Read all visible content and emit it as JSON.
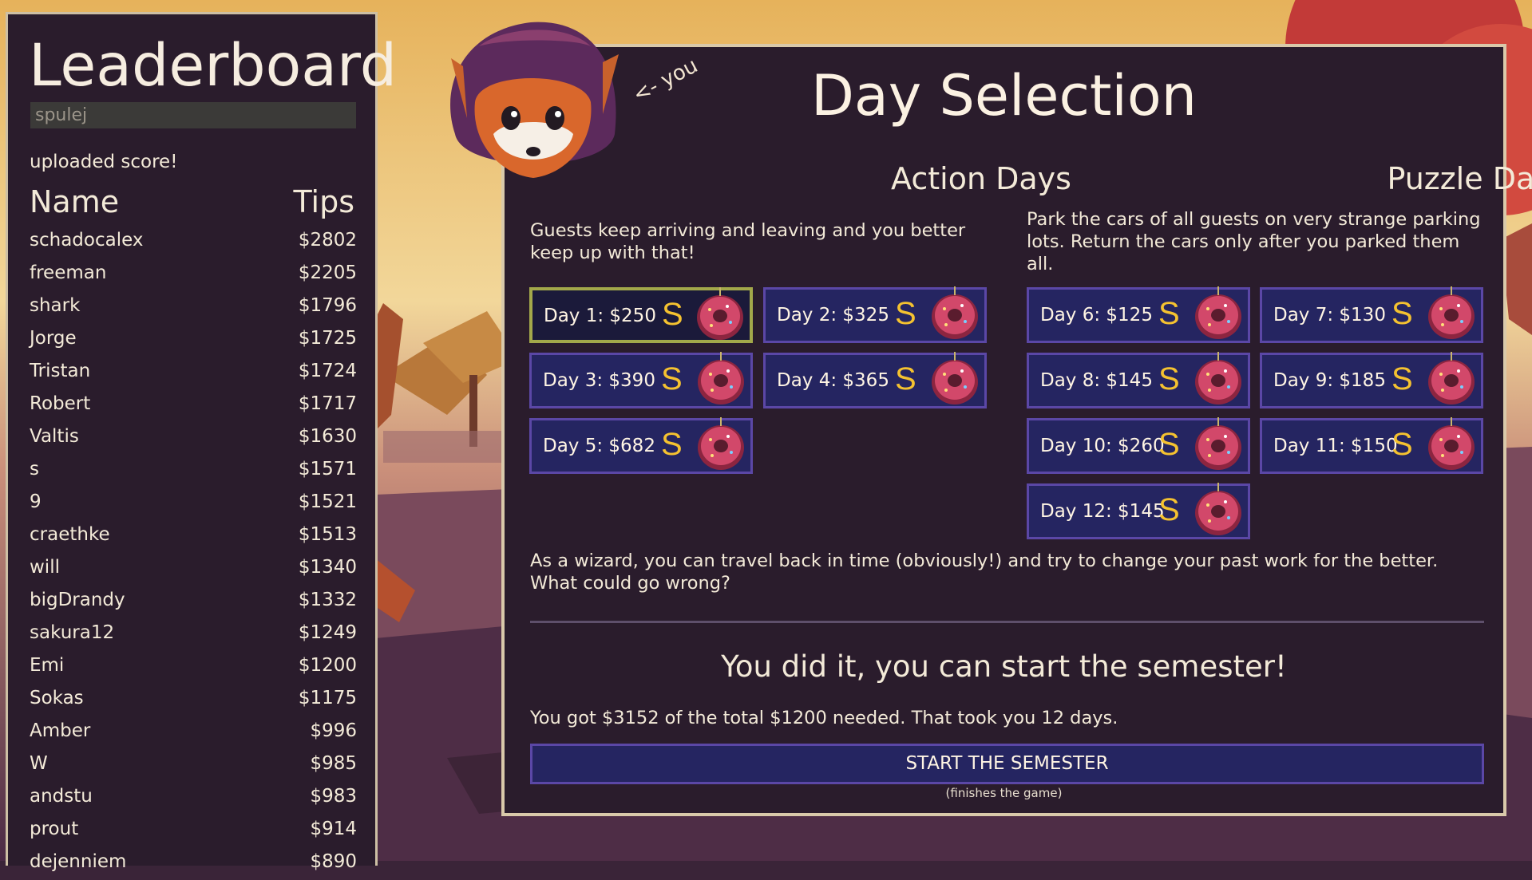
{
  "leaderboard": {
    "title": "Leaderboard",
    "username_value": "spulej",
    "status": "uploaded score!",
    "col_name": "Name",
    "col_tips": "Tips",
    "rows": [
      {
        "name": "schadocalex",
        "tips": "$2802"
      },
      {
        "name": "freeman",
        "tips": "$2205"
      },
      {
        "name": "shark",
        "tips": "$1796"
      },
      {
        "name": "Jorge",
        "tips": "$1725"
      },
      {
        "name": "Tristan",
        "tips": "$1724"
      },
      {
        "name": "Robert",
        "tips": "$1717"
      },
      {
        "name": "Valtis",
        "tips": "$1630"
      },
      {
        "name": "s",
        "tips": "$1571"
      },
      {
        "name": "9",
        "tips": "$1521"
      },
      {
        "name": "craethke",
        "tips": "$1513"
      },
      {
        "name": "will",
        "tips": "$1340"
      },
      {
        "name": "bigDrandy",
        "tips": "$1332"
      },
      {
        "name": "sakura12",
        "tips": "$1249"
      },
      {
        "name": "Emi",
        "tips": "$1200"
      },
      {
        "name": "Sokas",
        "tips": "$1175"
      },
      {
        "name": "Amber",
        "tips": "$996"
      },
      {
        "name": "W",
        "tips": "$985"
      },
      {
        "name": "andstu",
        "tips": "$983"
      },
      {
        "name": "prout",
        "tips": "$914"
      },
      {
        "name": "dejenniem",
        "tips": "$890"
      }
    ]
  },
  "character": {
    "you_label": "<- you",
    "icon": "fox-wizard-hood-icon"
  },
  "panel": {
    "title": "Day Selection",
    "action": {
      "title": "Action Days",
      "description": "Guests keep arriving and leaving and you better keep up with that!",
      "days": [
        {
          "label": "Day 1: $250",
          "selected": true
        },
        {
          "label": "Day 2: $325",
          "selected": false
        },
        {
          "label": "Day 3: $390",
          "selected": false
        },
        {
          "label": "Day 4: $365",
          "selected": false
        },
        {
          "label": "Day 5: $682",
          "selected": false
        }
      ]
    },
    "puzzle": {
      "title": "Puzzle Days",
      "description": "Park the cars of all guests on very strange parking lots. Return the cars only after you parked them all.",
      "days": [
        {
          "label": "Day 6: $125"
        },
        {
          "label": "Day 7: $130"
        },
        {
          "label": "Day 8: $145"
        },
        {
          "label": "Day 9: $185"
        },
        {
          "label": "Day 10: $260"
        },
        {
          "label": "Day 11: $150"
        },
        {
          "label": "Day 12: $145"
        }
      ]
    },
    "day_icons": [
      "S-grade-icon",
      "donut-icon"
    ],
    "story": "As a wizard, you can travel back in time (obviously!) and try to change your past work for the better. What could go wrong?",
    "win_title": "You did it, you can start the semester!",
    "result": "You got $3152 of the total $1200 needed. That took you 12 days.",
    "start_button": "START THE SEMESTER",
    "start_note": "(finishes the game)"
  },
  "colors": {
    "panel_bg": "#2a1c2c",
    "button_bg": "#252561",
    "button_border": "#5b47a6",
    "selected_border": "#a3a84a",
    "grade_yellow": "#f5c230"
  }
}
